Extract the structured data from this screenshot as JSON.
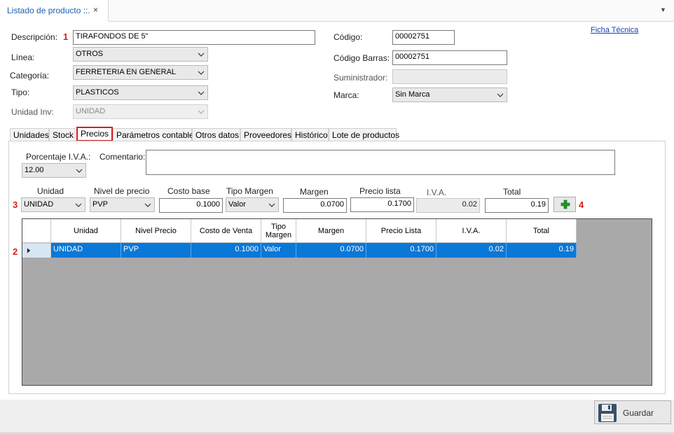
{
  "doc_tab": {
    "title": "Listado de producto ::.",
    "close": "×",
    "menu": "▼"
  },
  "header": {
    "descripcion": {
      "label": "Descripción:",
      "value": "TIRAFONDOS DE 5\"",
      "marker": "1"
    },
    "linea": {
      "label": "Línea:",
      "value": "OTROS"
    },
    "categoria": {
      "label": "Categoría:",
      "value": "FERRETERIA EN GENERAL"
    },
    "tipo": {
      "label": "Tipo:",
      "value": "PLASTICOS"
    },
    "unidad_inv": {
      "label": "Unidad Inv:",
      "value": "UNIDAD"
    },
    "codigo": {
      "label": "Código:",
      "value": "00002751"
    },
    "codigo_barras": {
      "label": "Código Barras:",
      "value": "00002751"
    },
    "suministrador": {
      "label": "Suministrador:",
      "value": ""
    },
    "marca": {
      "label": "Marca:",
      "value": "Sin Marca"
    },
    "ficha_tecnica": "Ficha Técnica"
  },
  "tabs": [
    {
      "label": "Unidades"
    },
    {
      "label": "Stock"
    },
    {
      "label": "Precios",
      "active": true
    },
    {
      "label": "Parámetros contables"
    },
    {
      "label": "Otros datos"
    },
    {
      "label": "Proveedores"
    },
    {
      "label": "Histórico"
    },
    {
      "label": "Lote de productos"
    }
  ],
  "precios": {
    "iva_label": "Porcentaje I.V.A.:",
    "iva_value": "12.00",
    "comentario_label": "Comentario:",
    "comentario_value": "",
    "entry": {
      "marker": "3",
      "unidad": {
        "label": "Unidad",
        "value": "UNIDAD"
      },
      "nivel": {
        "label": "Nivel de precio",
        "value": "PVP"
      },
      "costo": {
        "label": "Costo base",
        "value": "0.1000"
      },
      "tipo_margen": {
        "label": "Tipo Margen",
        "value": "Valor"
      },
      "margen": {
        "label": "Margen",
        "value": "0.0700"
      },
      "precio_lista": {
        "label": "Precio lista",
        "value": "0.1700"
      },
      "iva": {
        "label": "I.V.A.",
        "value": "0.02"
      },
      "total": {
        "label": "Total",
        "value": "0.19"
      },
      "add_marker": "4"
    },
    "grid": {
      "marker": "2",
      "columns": [
        "Unidad",
        "Nivel Precio",
        "Costo de Venta",
        "Tipo\nMargen",
        "Margen",
        "Precio Lista",
        "I.V.A.",
        "Total"
      ],
      "rows": [
        [
          "UNIDAD",
          "PVP",
          "0.1000",
          "Valor",
          "0.0700",
          "0.1700",
          "0.02",
          "0.19"
        ]
      ]
    }
  },
  "footer": {
    "save_label": "Guardar"
  },
  "colors": {
    "accent": "#0a78d7",
    "marker_red": "#d81e1e",
    "link": "#1b3fb5"
  }
}
